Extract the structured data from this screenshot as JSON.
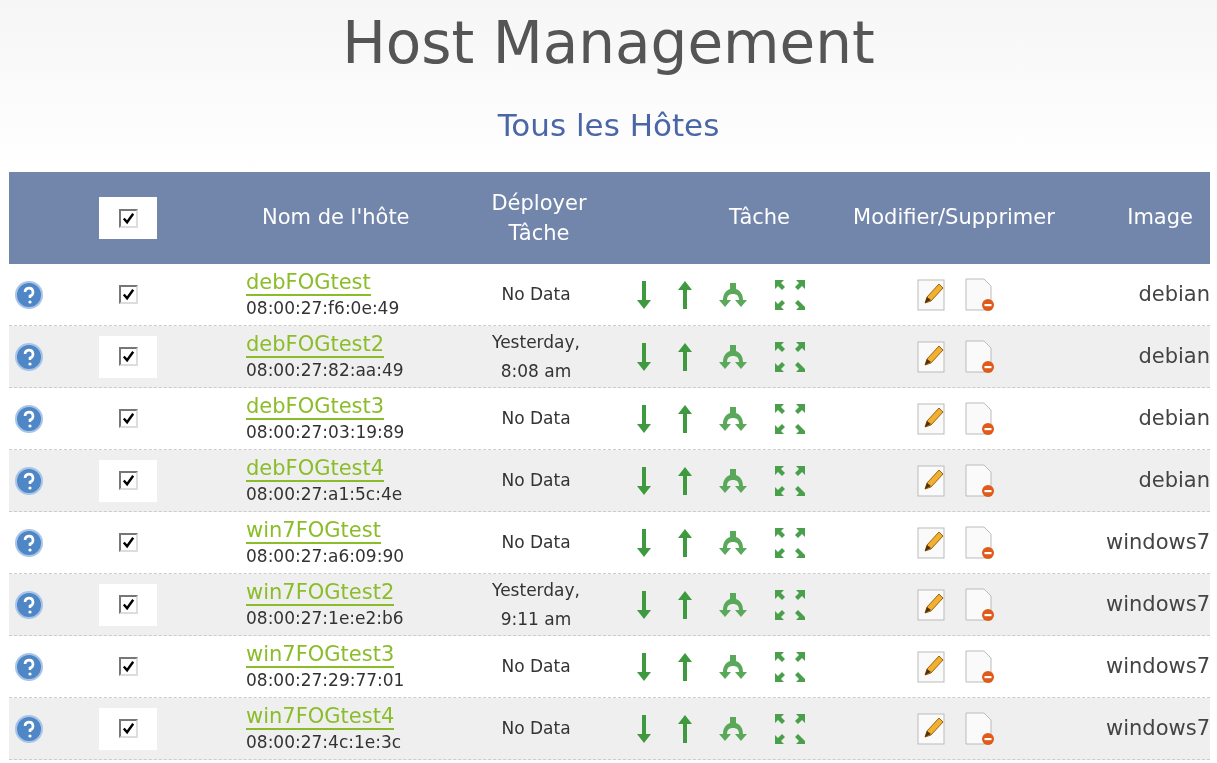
{
  "title": "Host Management",
  "subtitle": "Tous les Hôtes",
  "table": {
    "select_all_checked": true,
    "columns": [
      "Nom de l'hôte",
      "Déployer Tâche",
      "Tâche",
      "Modifier/Supprimer",
      "Image"
    ],
    "rows": [
      {
        "name": "debFOGtest",
        "mac": "08:00:27:f6:0e:49",
        "deployed": "No Data",
        "image": "debian",
        "checked": true
      },
      {
        "name": "debFOGtest2",
        "mac": "08:00:27:82:aa:49",
        "deployed": "Yesterday, 8:08 am",
        "image": "debian",
        "checked": true
      },
      {
        "name": "debFOGtest3",
        "mac": "08:00:27:03:19:89",
        "deployed": "No Data",
        "image": "debian",
        "checked": true
      },
      {
        "name": "debFOGtest4",
        "mac": "08:00:27:a1:5c:4e",
        "deployed": "No Data",
        "image": "debian",
        "checked": true
      },
      {
        "name": "win7FOGtest",
        "mac": "08:00:27:a6:09:90",
        "deployed": "No Data",
        "image": "windows7",
        "checked": true
      },
      {
        "name": "win7FOGtest2",
        "mac": "08:00:27:1e:e2:b6",
        "deployed": "Yesterday, 9:11 am",
        "image": "windows7",
        "checked": true
      },
      {
        "name": "win7FOGtest3",
        "mac": "08:00:27:29:77:01",
        "deployed": "No Data",
        "image": "windows7",
        "checked": true
      },
      {
        "name": "win7FOGtest4",
        "mac": "08:00:27:4c:1e:3c",
        "deployed": "No Data",
        "image": "windows7",
        "checked": true
      }
    ]
  }
}
